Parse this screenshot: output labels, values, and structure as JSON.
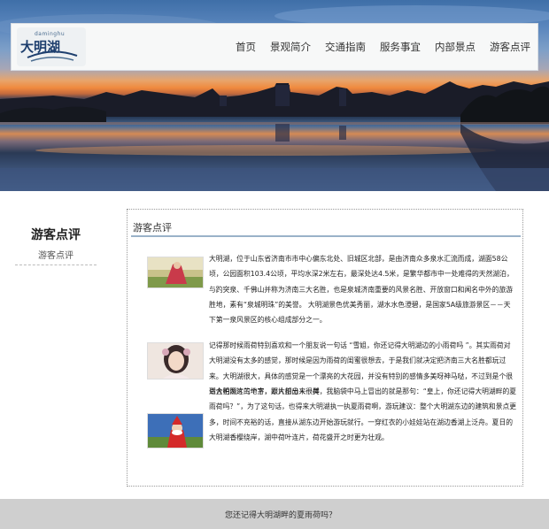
{
  "logo": {
    "subtitle": "daminghu",
    "text": "大明湖"
  },
  "nav": {
    "items": [
      "首页",
      "景观简介",
      "交通指南",
      "服务事宜",
      "内部景点",
      "游客点评"
    ]
  },
  "side": {
    "title": "游客点评",
    "subtitle": "游客点评"
  },
  "content": {
    "title": "游客点评",
    "paragraphs": [
      "大明湖，位于山东省济南市市中心偏东北处、旧城区北部，是由济南众多泉水汇流而成，湖面58公顷，公园面积103.4公顷，平均水深2米左右，最深处达4.5米，是繁华都市中一处难得的天然湖泊，与趵突泉、千佛山并称为济南三大名胜，也是泉城济南重要的风景名胜、开放窗口和闻名中外的旅游胜地，素有“泉城明珠”的美誉。 大明湖景色优美秀丽，湖水水色澄碧，是国家5A级旅游景区－－天下第一泉风景区的核心组成部分之一。",
      "记得那时候雨荷特别喜欢和一个朋友说一句话 “雪姐，你还记得大明湖边的小雨荷吗 ”。其实雨荷对大明湖没有太多的感觉，那时候是因为雨荷的闺蜜很想去，于是我们就决定把济南三大名胜都玩过来。大明湖很大，具体的感觉是一个漂亮的大花园，并没有特别的感情多美呀神马哒，不过到是个很适合拍照片的地方，照片拍出来很美",
      "到大明湖这三个字，跟大部分人一样，我脑袋中马上冒出的就是那句：“皇上，你还记得大明湖畔的夏雨荷吗？”，为了这句话，也得来大明湖执一执夏雨荷啊，游玩建议：整个大明湖东边的建筑和景点更多，时间不充裕的话，直接从湖东边开始游玩就行。一穿红衣的小娃娃站在湖边香湖上泛舟。夏日的大明湖香樱绕岸，湖中荷叶连片，荷花盛开之时更为壮观。"
    ]
  },
  "footer": {
    "text": "您还记得大明湖畔的夏雨荷吗？"
  },
  "colors": {
    "accent_rule": "#9ab2c9",
    "footer_bg": "#cfcfcf",
    "brand": "#1e3f6e"
  },
  "icons": [
    "logo-emblem",
    "hero-photo",
    "thumb-lotus-lady",
    "thumb-costume-girl",
    "thumb-santa"
  ]
}
